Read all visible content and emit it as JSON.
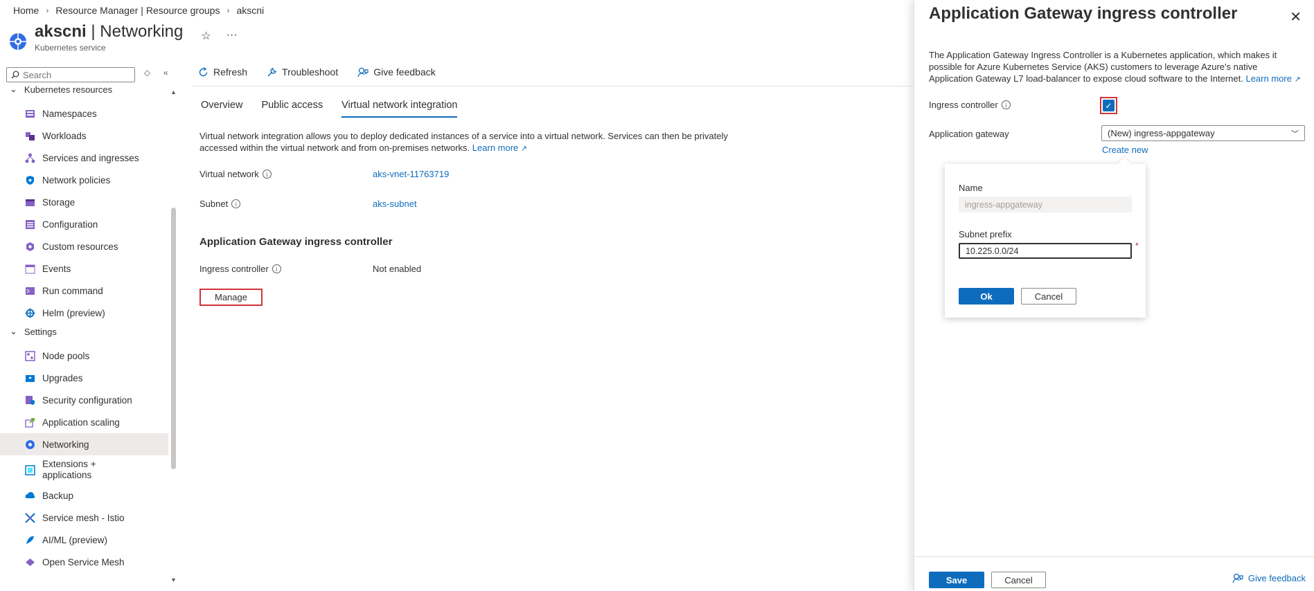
{
  "breadcrumb": [
    "Home",
    "Resource Manager | Resource groups",
    "akscni"
  ],
  "header": {
    "resource_name": "akscni",
    "separator": " | ",
    "page": "Networking",
    "subtitle": "Kubernetes service",
    "more": "···"
  },
  "sidebar": {
    "search_placeholder": "Search",
    "sections": [
      {
        "label": "Kubernetes resources"
      },
      {
        "label": "Settings"
      }
    ],
    "items": [
      {
        "label": "Namespaces",
        "icon": "namespaces-icon"
      },
      {
        "label": "Workloads",
        "icon": "workloads-icon"
      },
      {
        "label": "Services and ingresses",
        "icon": "services-icon"
      },
      {
        "label": "Network policies",
        "icon": "network-policies-icon"
      },
      {
        "label": "Storage",
        "icon": "storage-icon"
      },
      {
        "label": "Configuration",
        "icon": "configuration-icon"
      },
      {
        "label": "Custom resources",
        "icon": "custom-resources-icon"
      },
      {
        "label": "Events",
        "icon": "events-icon"
      },
      {
        "label": "Run command",
        "icon": "run-command-icon"
      },
      {
        "label": "Helm (preview)",
        "icon": "helm-icon"
      },
      {
        "label": "Node pools",
        "icon": "node-pools-icon"
      },
      {
        "label": "Upgrades",
        "icon": "upgrades-icon"
      },
      {
        "label": "Security configuration",
        "icon": "security-icon"
      },
      {
        "label": "Application scaling",
        "icon": "scaling-icon"
      },
      {
        "label": "Networking",
        "icon": "networking-icon"
      },
      {
        "label": "Extensions + applications",
        "icon": "extensions-icon"
      },
      {
        "label": "Backup",
        "icon": "backup-icon"
      },
      {
        "label": "Service mesh - Istio",
        "icon": "service-mesh-icon"
      },
      {
        "label": "AI/ML (preview)",
        "icon": "ai-ml-icon"
      },
      {
        "label": "Open Service Mesh",
        "icon": "open-service-mesh-icon"
      }
    ]
  },
  "toolbar": {
    "refresh": "Refresh",
    "troubleshoot": "Troubleshoot",
    "feedback": "Give feedback"
  },
  "tabs": [
    "Overview",
    "Public access",
    "Virtual network integration"
  ],
  "main": {
    "description": "Virtual network integration allows you to deploy dedicated instances of a service into a virtual network. Services can then be privately accessed within the virtual network and from on-premises networks.",
    "learn_more": "Learn more",
    "vnet_label": "Virtual network",
    "vnet_value": "aks-vnet-11763719",
    "subnet_label": "Subnet",
    "subnet_value": "aks-subnet",
    "agic_heading": "Application Gateway ingress controller",
    "ingress_label": "Ingress controller",
    "ingress_value": "Not enabled",
    "manage_button": "Manage"
  },
  "panel": {
    "title": "Application Gateway ingress controller",
    "description": "The Application Gateway Ingress Controller is a Kubernetes application, which makes it possible for Azure Kubernetes Service (AKS) customers to leverage Azure's native Application Gateway L7 load-balancer to expose cloud software to the Internet.",
    "learn_more": "Learn more",
    "ingress_label": "Ingress controller",
    "ingress_checked": true,
    "appgw_label": "Application gateway",
    "appgw_selected": "(New) ingress-appgateway",
    "create_new": "Create new",
    "popup": {
      "name_label": "Name",
      "name_value": "ingress-appgateway",
      "subnet_label": "Subnet prefix",
      "subnet_value": "10.225.0.0/24",
      "required_mark": "*",
      "ok": "Ok",
      "cancel": "Cancel"
    },
    "save": "Save",
    "cancel": "Cancel",
    "feedback": "Give feedback"
  },
  "colors": {
    "accent": "#0f6cbd",
    "highlight_border": "#d13438",
    "active_nav": "#edebe9"
  }
}
